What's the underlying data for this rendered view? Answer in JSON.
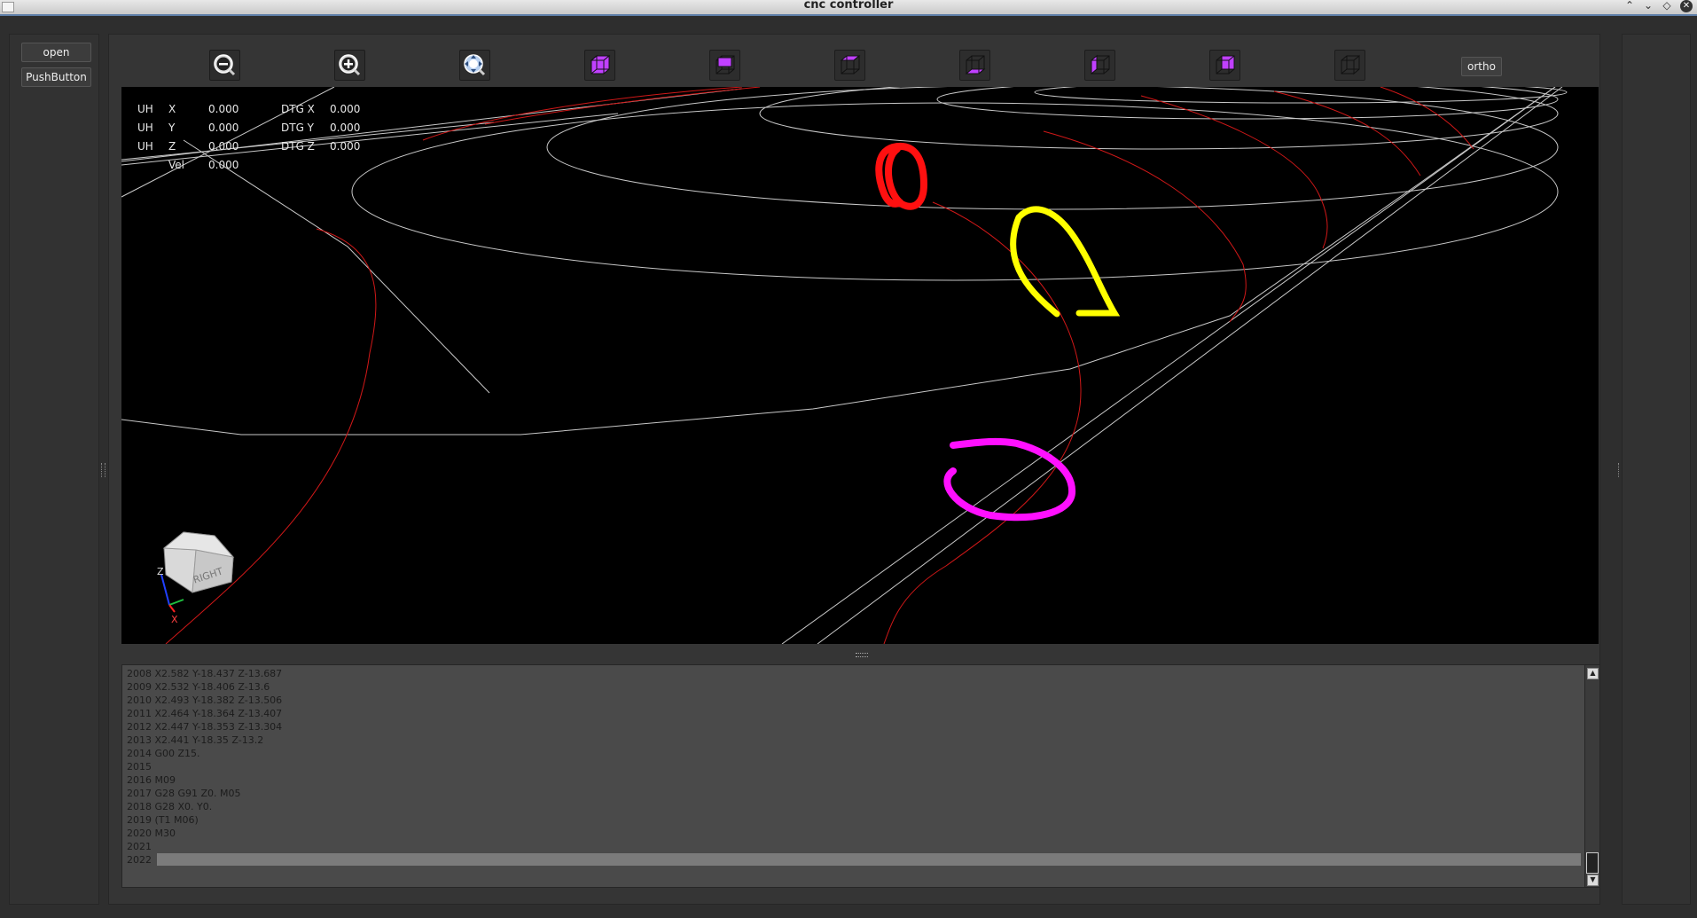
{
  "window": {
    "title": "cnc controller"
  },
  "left_panel": {
    "open_label": "open",
    "push_label": "PushButton"
  },
  "toolbar": {
    "buttons": [
      "zoom-out",
      "zoom-in",
      "zoom-fit",
      "view-iso",
      "view-top",
      "view-front",
      "view-bottom",
      "view-left",
      "view-back",
      "view-right"
    ],
    "ortho_label": "ortho"
  },
  "dro": {
    "rows": [
      {
        "prefix": "UH",
        "axis": "X",
        "value": "0.000",
        "dtg_label": "DTG X",
        "dtg_value": "0.000"
      },
      {
        "prefix": "UH",
        "axis": "Y",
        "value": "0.000",
        "dtg_label": "DTG Y",
        "dtg_value": "0.000"
      },
      {
        "prefix": "UH",
        "axis": "Z",
        "value": "0.000",
        "dtg_label": "DTG Z",
        "dtg_value": "0.000"
      }
    ],
    "vel_label": "Vel",
    "vel_value": "0.000"
  },
  "view_cube": {
    "face_label": "RIGHT",
    "axis_z": "Z",
    "axis_x": "X"
  },
  "gcode": {
    "lines": [
      "2008 X2.582 Y-18.437 Z-13.687",
      "2009 X2.532 Y-18.406 Z-13.6",
      "2010 X2.493 Y-18.382 Z-13.506",
      "2011 X2.464 Y-18.364 Z-13.407",
      "2012 X2.447 Y-18.353 Z-13.304",
      "2013 X2.441 Y-18.35 Z-13.2",
      "2014 G00 Z15.",
      "2015",
      "2016 M09",
      "2017 G28 G91 Z0. M05",
      "2018 G28 X0. Y0.",
      "2019 (T1 M06)",
      "2020 M30",
      "2021",
      "2022"
    ]
  },
  "colors": {
    "rapid": "#c8c8c8",
    "feed": "#d01818",
    "tool_marker_red": "#ff1010",
    "tool_marker_yellow": "#ffff00",
    "tool_marker_magenta": "#ff10ff",
    "view_face": "#c040ff"
  }
}
